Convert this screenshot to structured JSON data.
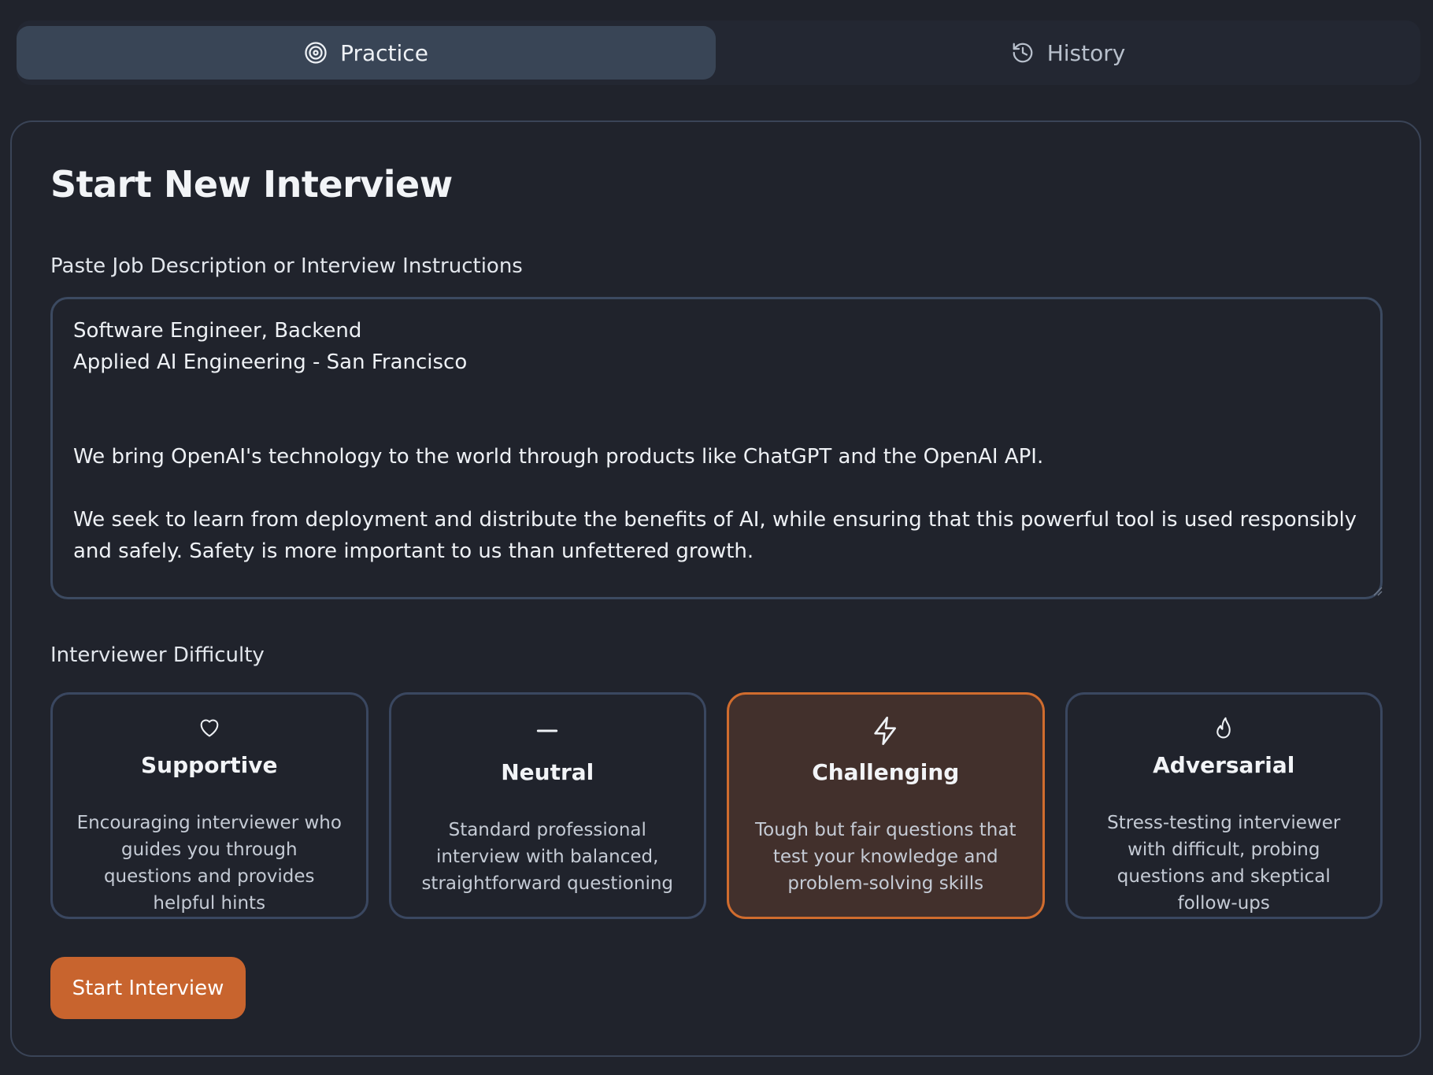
{
  "tabs": {
    "practice": {
      "label": "Practice",
      "icon": "target-icon",
      "active": true
    },
    "history": {
      "label": "History",
      "icon": "history-icon",
      "active": false
    }
  },
  "form": {
    "title": "Start New Interview",
    "description_label": "Paste Job Description or Interview Instructions",
    "description_value": "Software Engineer, Backend\nApplied AI Engineering - San Francisco\n\n\nWe bring OpenAI's technology to the world through products like ChatGPT and the OpenAI API.\n\nWe seek to learn from deployment and distribute the benefits of AI, while ensuring that this powerful tool is used responsibly and safely. Safety is more important to us than unfettered growth.",
    "difficulty_label": "Interviewer Difficulty",
    "difficulties": [
      {
        "title": "Supportive",
        "icon": "heart-icon",
        "description": "Encouraging interviewer who guides you through questions and provides helpful hints",
        "selected": false
      },
      {
        "title": "Neutral",
        "icon": "minus-icon",
        "description": "Standard professional interview with balanced, straightforward questioning",
        "selected": false
      },
      {
        "title": "Challenging",
        "icon": "lightning-icon",
        "description": "Tough but fair questions that test your knowledge and problem-solving skills",
        "selected": true
      },
      {
        "title": "Adversarial",
        "icon": "flame-icon",
        "description": "Stress-testing interviewer with difficult, probing questions and skeptical follow-ups",
        "selected": false
      }
    ],
    "start_label": "Start Interview"
  },
  "colors": {
    "background": "#20232c",
    "accent": "#c8642e",
    "selected_border": "#d06c2e",
    "selected_background": "#42302c",
    "active_tab": "#394556"
  }
}
